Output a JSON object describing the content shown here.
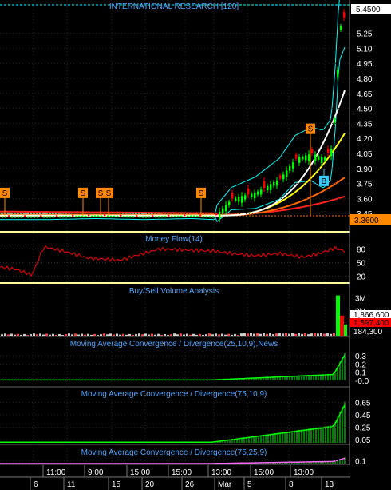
{
  "title": "INTERNATIONAL RESEARCH [120]",
  "colors": {
    "up": "#00ff00",
    "down": "#ff0000",
    "boll": "#00ffff",
    "ma_fast": "#ffffff",
    "ma_mid": "#ffff00",
    "ma_slow1": "#ff6600",
    "ma_slow2": "#ff2222",
    "mfi": "#ff0000",
    "macd": "#00ff00",
    "panel_title": "#4da6ff",
    "separator": "#ffff99",
    "sell_marker": "#ff8800",
    "buy_marker": "#33ccff"
  },
  "price_panel": {
    "ylim": [
      3.3,
      5.55
    ],
    "tick_labels": [
      "5.25",
      "5.10",
      "4.95",
      "4.80",
      "4.65",
      "4.50",
      "4.35",
      "4.20",
      "4.05",
      "3.90",
      "3.75",
      "3.60",
      "3.45"
    ],
    "tick_values": [
      5.25,
      5.1,
      4.95,
      4.8,
      4.65,
      4.5,
      4.35,
      4.2,
      4.05,
      3.9,
      3.75,
      3.6,
      3.45
    ],
    "last_price_label": "5.4500",
    "last_price": 5.45,
    "ref_price_label": "3.3600",
    "ref_price": 3.36,
    "markers": [
      {
        "label": "S",
        "type": "sell",
        "x": 6,
        "price": 3.66
      },
      {
        "label": "S",
        "type": "sell",
        "x": 104,
        "price": 3.66
      },
      {
        "label": "S",
        "type": "sell",
        "x": 126,
        "price": 3.66
      },
      {
        "label": "S",
        "type": "sell",
        "x": 136,
        "price": 3.66
      },
      {
        "label": "S",
        "type": "sell",
        "x": 252,
        "price": 3.66
      },
      {
        "label": "S",
        "type": "sell",
        "x": 389,
        "price": 4.3
      },
      {
        "label": "B",
        "type": "buy",
        "x": 406,
        "price": 3.78
      }
    ]
  },
  "chart_data": {
    "type": "line",
    "series": [
      {
        "name": "Price",
        "x": [
          0,
          60,
          120,
          180,
          240,
          268,
          290,
          320,
          350,
          370,
          390,
          405,
          415,
          420,
          425,
          432
        ],
        "values": [
          3.42,
          3.42,
          3.43,
          3.42,
          3.43,
          3.42,
          3.6,
          3.66,
          3.8,
          4.0,
          4.05,
          4.0,
          4.1,
          4.6,
          5.3,
          5.45
        ]
      },
      {
        "name": "Money Flow(14)",
        "x": [
          0,
          20,
          40,
          55,
          80,
          110,
          150,
          180,
          200,
          230,
          270,
          290,
          320,
          350,
          380,
          400,
          420,
          432
        ],
        "values": [
          40,
          35,
          22,
          85,
          75,
          60,
          55,
          70,
          80,
          78,
          75,
          70,
          65,
          70,
          62,
          70,
          82,
          75
        ]
      }
    ]
  },
  "mfi_panel": {
    "title": "Money Flow(14)",
    "ylim": [
      10,
      95
    ],
    "tick_labels": [
      "80",
      "50",
      "20"
    ],
    "tick_values": [
      80,
      50,
      20
    ]
  },
  "volume_panel": {
    "title": "Buy/Sell Volume Analysis",
    "ylim": [
      0,
      3300000
    ],
    "tick_labels": [
      "3M",
      "2M"
    ],
    "tick_values": [
      3000000,
      2000000
    ],
    "buy_label": "1,866,600",
    "sell_label": "1,597,400",
    "total_label": "184,300"
  },
  "macd_panels": [
    {
      "title": "Moving Average Convergence / Divergence(25,10,9),News",
      "ylim": [
        -0.06,
        0.4
      ],
      "tick_labels": [
        "0.3",
        "0.2",
        "0.1",
        "-0.0"
      ],
      "tick_values": [
        0.3,
        0.2,
        0.1,
        0.0
      ]
    },
    {
      "title": "Moving Average Convergence / Divergence(75,10,9)",
      "ylim": [
        0.0,
        0.72
      ],
      "tick_labels": [
        "0.65",
        "0.45",
        "0.25",
        "0.05"
      ],
      "tick_values": [
        0.65,
        0.45,
        0.25,
        0.05
      ]
    },
    {
      "title": "Moving Average Convergence / Divergence(75,25,9)",
      "ylim": [
        0.05,
        0.17
      ],
      "tick_labels": [
        "0.1"
      ],
      "tick_values": [
        0.1
      ]
    }
  ],
  "time_axis": {
    "top_labels": [
      {
        "text": "11:00",
        "x": 58
      },
      {
        "text": "9:00",
        "x": 110
      },
      {
        "text": "15:00",
        "x": 163
      },
      {
        "text": "15:00",
        "x": 215
      },
      {
        "text": "13:00",
        "x": 265
      },
      {
        "text": "15:00",
        "x": 318
      },
      {
        "text": "13:00",
        "x": 368
      }
    ],
    "bottom_labels": [
      {
        "text": "6",
        "x": 42
      },
      {
        "text": "11",
        "x": 84
      },
      {
        "text": "15",
        "x": 140
      },
      {
        "text": "20",
        "x": 182
      },
      {
        "text": "26",
        "x": 232
      },
      {
        "text": "Mar",
        "x": 273
      },
      {
        "text": "5",
        "x": 310
      },
      {
        "text": "8",
        "x": 362
      },
      {
        "text": "13",
        "x": 407
      }
    ]
  }
}
